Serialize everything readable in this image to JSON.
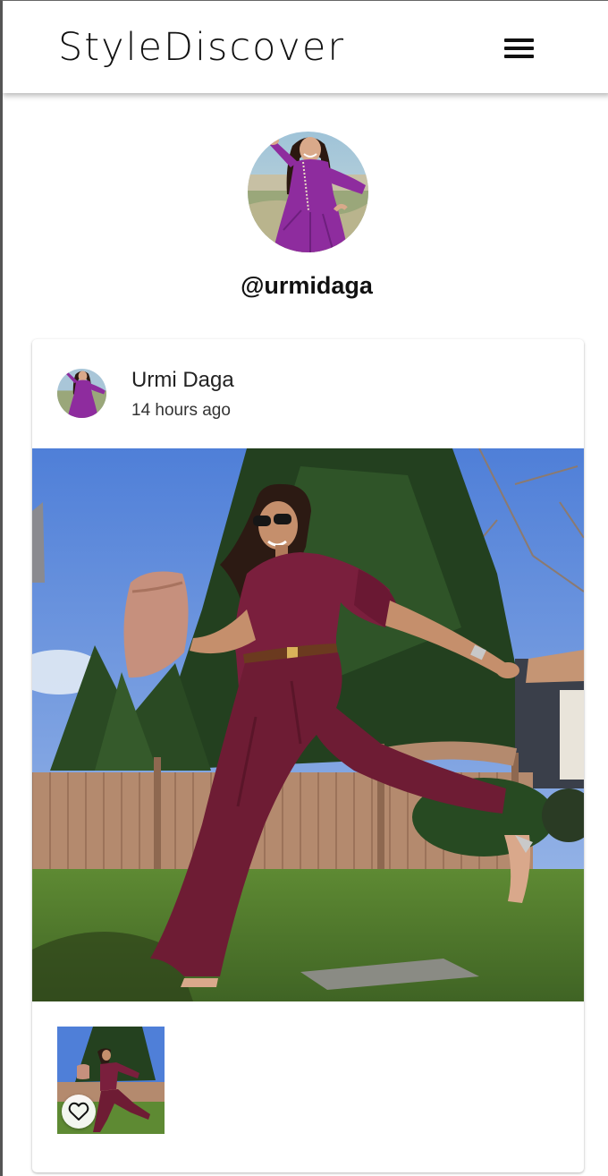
{
  "header": {
    "brand": "StyleDiscover",
    "menu_icon": "hamburger-menu-icon"
  },
  "profile": {
    "handle": "@urmidaga",
    "avatar_icon": "profile-avatar"
  },
  "post": {
    "author_name": "Urmi Daga",
    "time_ago": "14 hours ago",
    "like_icon": "heart-outline-icon"
  },
  "colors": {
    "text": "#111111",
    "header_bg": "#ffffff",
    "card_bg": "#ffffff",
    "outfit_maroon": "#7a1f3d",
    "avatar_dress_purple": "#8e2c9e"
  }
}
